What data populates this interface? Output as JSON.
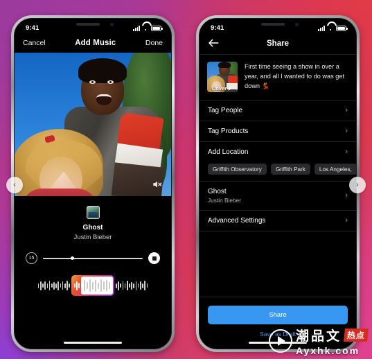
{
  "background": {
    "gradient_from": "#a13aa7",
    "gradient_via": "#c8356f",
    "gradient_to": "#d0408f"
  },
  "carousel": {
    "prev_icon": "chevron-left-icon",
    "next_icon": "chevron-right-icon",
    "prev_glyph": "‹",
    "next_glyph": "›"
  },
  "left_phone": {
    "status_bar": {
      "time": "9:41",
      "signal_icon": "cellular-bars-icon",
      "wifi_icon": "wifi-icon",
      "battery_icon": "battery-icon"
    },
    "navbar": {
      "cancel_label": "Cancel",
      "title": "Add Music",
      "done_label": "Done"
    },
    "video": {
      "mute_icon": "speaker-mute-icon"
    },
    "music": {
      "album_art_icon": "album-artwork-icon",
      "title": "Ghost",
      "artist": "Justin Bieber",
      "duration_badge": "15",
      "stop_icon": "stop-square-icon",
      "slider_position_percent": 28
    },
    "waveform": {
      "selection_label": "audio-trim-selection"
    }
  },
  "right_phone": {
    "status_bar": {
      "time": "9:41",
      "signal_icon": "cellular-bars-icon",
      "wifi_icon": "wifi-icon",
      "battery_icon": "battery-icon"
    },
    "navbar": {
      "back_icon": "back-arrow-icon",
      "title": "Share"
    },
    "caption": {
      "cover_label": "Cover",
      "edit_icon": "pencil-icon",
      "text": "First time seeing a show in over a year, and all I wanted to do was get down 💃"
    },
    "rows": [
      {
        "label": "Tag People",
        "sub": "",
        "chevron": "›"
      },
      {
        "label": "Tag Products",
        "sub": "",
        "chevron": "›"
      },
      {
        "label": "Add Location",
        "sub": "",
        "chevron": "›"
      },
      {
        "label": "Ghost",
        "sub": "Justin Bieber",
        "chevron": "›"
      },
      {
        "label": "Advanced Settings",
        "sub": "",
        "chevron": "›"
      }
    ],
    "location_chips": [
      "Griffith Observatory",
      "Griffith Park",
      "Los Angeles, "
    ],
    "share_button": {
      "label": "Share",
      "color": "#3897f0"
    },
    "draft_button": {
      "label": "Save as Draft",
      "color": "#3897f0"
    }
  },
  "watermark": {
    "play_icon": "play-circle-icon",
    "brand_cn": "潮品文",
    "badge_cn": "热点",
    "url": "Ayxhk.com",
    "badge_color": "#d62b1f"
  }
}
